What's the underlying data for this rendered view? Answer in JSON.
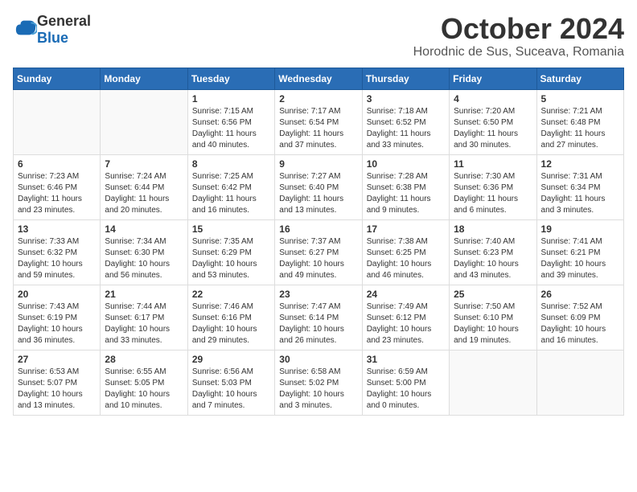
{
  "logo": {
    "general": "General",
    "blue": "Blue"
  },
  "header": {
    "month": "October 2024",
    "location": "Horodnic de Sus, Suceava, Romania"
  },
  "weekdays": [
    "Sunday",
    "Monday",
    "Tuesday",
    "Wednesday",
    "Thursday",
    "Friday",
    "Saturday"
  ],
  "weeks": [
    [
      {
        "day": "",
        "info": ""
      },
      {
        "day": "",
        "info": ""
      },
      {
        "day": "1",
        "info": "Sunrise: 7:15 AM\nSunset: 6:56 PM\nDaylight: 11 hours and 40 minutes."
      },
      {
        "day": "2",
        "info": "Sunrise: 7:17 AM\nSunset: 6:54 PM\nDaylight: 11 hours and 37 minutes."
      },
      {
        "day": "3",
        "info": "Sunrise: 7:18 AM\nSunset: 6:52 PM\nDaylight: 11 hours and 33 minutes."
      },
      {
        "day": "4",
        "info": "Sunrise: 7:20 AM\nSunset: 6:50 PM\nDaylight: 11 hours and 30 minutes."
      },
      {
        "day": "5",
        "info": "Sunrise: 7:21 AM\nSunset: 6:48 PM\nDaylight: 11 hours and 27 minutes."
      }
    ],
    [
      {
        "day": "6",
        "info": "Sunrise: 7:23 AM\nSunset: 6:46 PM\nDaylight: 11 hours and 23 minutes."
      },
      {
        "day": "7",
        "info": "Sunrise: 7:24 AM\nSunset: 6:44 PM\nDaylight: 11 hours and 20 minutes."
      },
      {
        "day": "8",
        "info": "Sunrise: 7:25 AM\nSunset: 6:42 PM\nDaylight: 11 hours and 16 minutes."
      },
      {
        "day": "9",
        "info": "Sunrise: 7:27 AM\nSunset: 6:40 PM\nDaylight: 11 hours and 13 minutes."
      },
      {
        "day": "10",
        "info": "Sunrise: 7:28 AM\nSunset: 6:38 PM\nDaylight: 11 hours and 9 minutes."
      },
      {
        "day": "11",
        "info": "Sunrise: 7:30 AM\nSunset: 6:36 PM\nDaylight: 11 hours and 6 minutes."
      },
      {
        "day": "12",
        "info": "Sunrise: 7:31 AM\nSunset: 6:34 PM\nDaylight: 11 hours and 3 minutes."
      }
    ],
    [
      {
        "day": "13",
        "info": "Sunrise: 7:33 AM\nSunset: 6:32 PM\nDaylight: 10 hours and 59 minutes."
      },
      {
        "day": "14",
        "info": "Sunrise: 7:34 AM\nSunset: 6:30 PM\nDaylight: 10 hours and 56 minutes."
      },
      {
        "day": "15",
        "info": "Sunrise: 7:35 AM\nSunset: 6:29 PM\nDaylight: 10 hours and 53 minutes."
      },
      {
        "day": "16",
        "info": "Sunrise: 7:37 AM\nSunset: 6:27 PM\nDaylight: 10 hours and 49 minutes."
      },
      {
        "day": "17",
        "info": "Sunrise: 7:38 AM\nSunset: 6:25 PM\nDaylight: 10 hours and 46 minutes."
      },
      {
        "day": "18",
        "info": "Sunrise: 7:40 AM\nSunset: 6:23 PM\nDaylight: 10 hours and 43 minutes."
      },
      {
        "day": "19",
        "info": "Sunrise: 7:41 AM\nSunset: 6:21 PM\nDaylight: 10 hours and 39 minutes."
      }
    ],
    [
      {
        "day": "20",
        "info": "Sunrise: 7:43 AM\nSunset: 6:19 PM\nDaylight: 10 hours and 36 minutes."
      },
      {
        "day": "21",
        "info": "Sunrise: 7:44 AM\nSunset: 6:17 PM\nDaylight: 10 hours and 33 minutes."
      },
      {
        "day": "22",
        "info": "Sunrise: 7:46 AM\nSunset: 6:16 PM\nDaylight: 10 hours and 29 minutes."
      },
      {
        "day": "23",
        "info": "Sunrise: 7:47 AM\nSunset: 6:14 PM\nDaylight: 10 hours and 26 minutes."
      },
      {
        "day": "24",
        "info": "Sunrise: 7:49 AM\nSunset: 6:12 PM\nDaylight: 10 hours and 23 minutes."
      },
      {
        "day": "25",
        "info": "Sunrise: 7:50 AM\nSunset: 6:10 PM\nDaylight: 10 hours and 19 minutes."
      },
      {
        "day": "26",
        "info": "Sunrise: 7:52 AM\nSunset: 6:09 PM\nDaylight: 10 hours and 16 minutes."
      }
    ],
    [
      {
        "day": "27",
        "info": "Sunrise: 6:53 AM\nSunset: 5:07 PM\nDaylight: 10 hours and 13 minutes."
      },
      {
        "day": "28",
        "info": "Sunrise: 6:55 AM\nSunset: 5:05 PM\nDaylight: 10 hours and 10 minutes."
      },
      {
        "day": "29",
        "info": "Sunrise: 6:56 AM\nSunset: 5:03 PM\nDaylight: 10 hours and 7 minutes."
      },
      {
        "day": "30",
        "info": "Sunrise: 6:58 AM\nSunset: 5:02 PM\nDaylight: 10 hours and 3 minutes."
      },
      {
        "day": "31",
        "info": "Sunrise: 6:59 AM\nSunset: 5:00 PM\nDaylight: 10 hours and 0 minutes."
      },
      {
        "day": "",
        "info": ""
      },
      {
        "day": "",
        "info": ""
      }
    ]
  ]
}
